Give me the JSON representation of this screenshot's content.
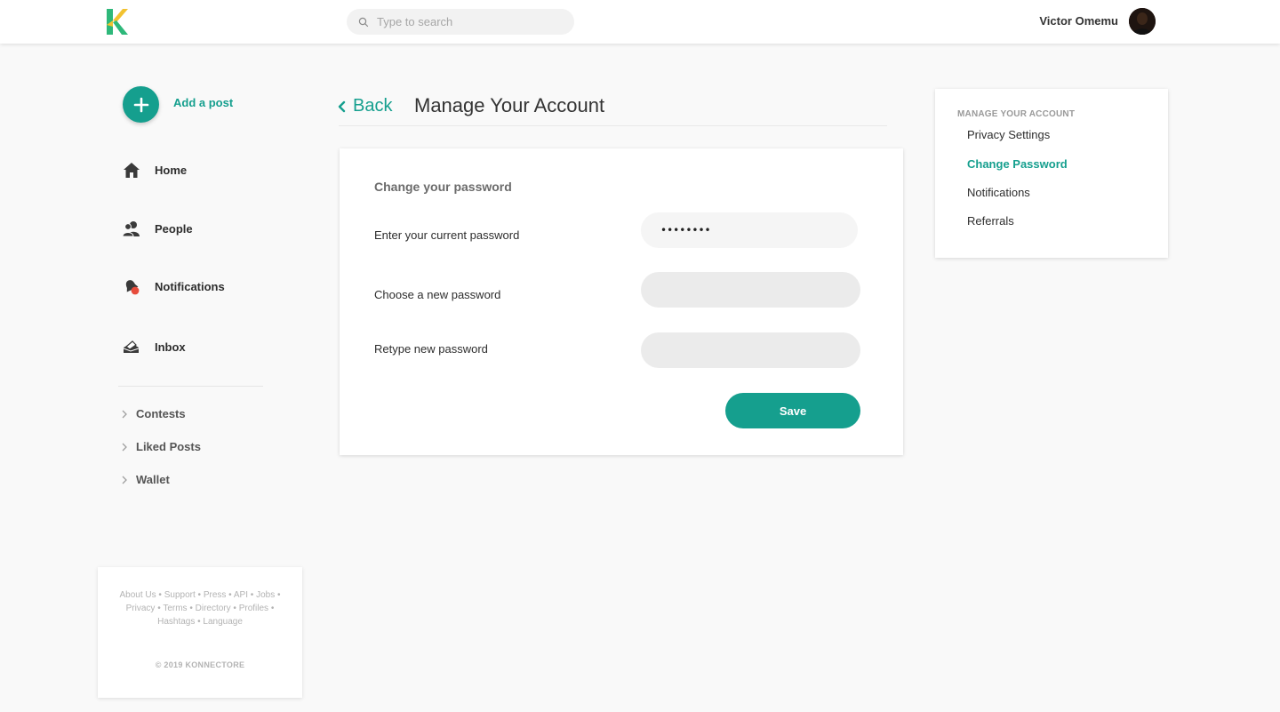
{
  "header": {
    "logo_letter": "K",
    "search_placeholder": "Type to search",
    "user_name": "Victor Omemu"
  },
  "sidebar": {
    "add_post_label": "Add a post",
    "nav": [
      {
        "label": "Home",
        "icon": "home-icon"
      },
      {
        "label": "People",
        "icon": "people-icon"
      },
      {
        "label": "Notifications",
        "icon": "notifications-icon"
      },
      {
        "label": "Inbox",
        "icon": "inbox-icon"
      }
    ],
    "sub_nav": [
      {
        "label": "Contests"
      },
      {
        "label": "Liked Posts"
      },
      {
        "label": "Wallet"
      }
    ],
    "footer": {
      "links": [
        "About Us",
        "Support",
        "Press",
        "API",
        "Jobs",
        "Privacy",
        "Terms",
        "Directory",
        "Profiles",
        "Hashtags",
        "Language"
      ],
      "copyright": "© 2019 KONNECTORE"
    }
  },
  "main": {
    "back_label": "Back",
    "title": "Manage Your Account",
    "form": {
      "heading": "Change your password",
      "current_label": "Enter your current password",
      "current_value": "••••••••",
      "new_label": "Choose a new password",
      "new_value": "",
      "retype_label": "Retype new password",
      "retype_value": "",
      "save_label": "Save"
    }
  },
  "account_menu": {
    "heading": "MANAGE YOUR ACCOUNT",
    "items": [
      {
        "label": "Privacy Settings",
        "active": false
      },
      {
        "label": "Change Password",
        "active": true
      },
      {
        "label": "Notifications",
        "active": false
      },
      {
        "label": "Referrals",
        "active": false
      }
    ]
  },
  "colors": {
    "accent": "#159f8e",
    "background": "#f9f9f9",
    "logo_green": "#2eb87a",
    "logo_yellow": "#f2c230"
  }
}
